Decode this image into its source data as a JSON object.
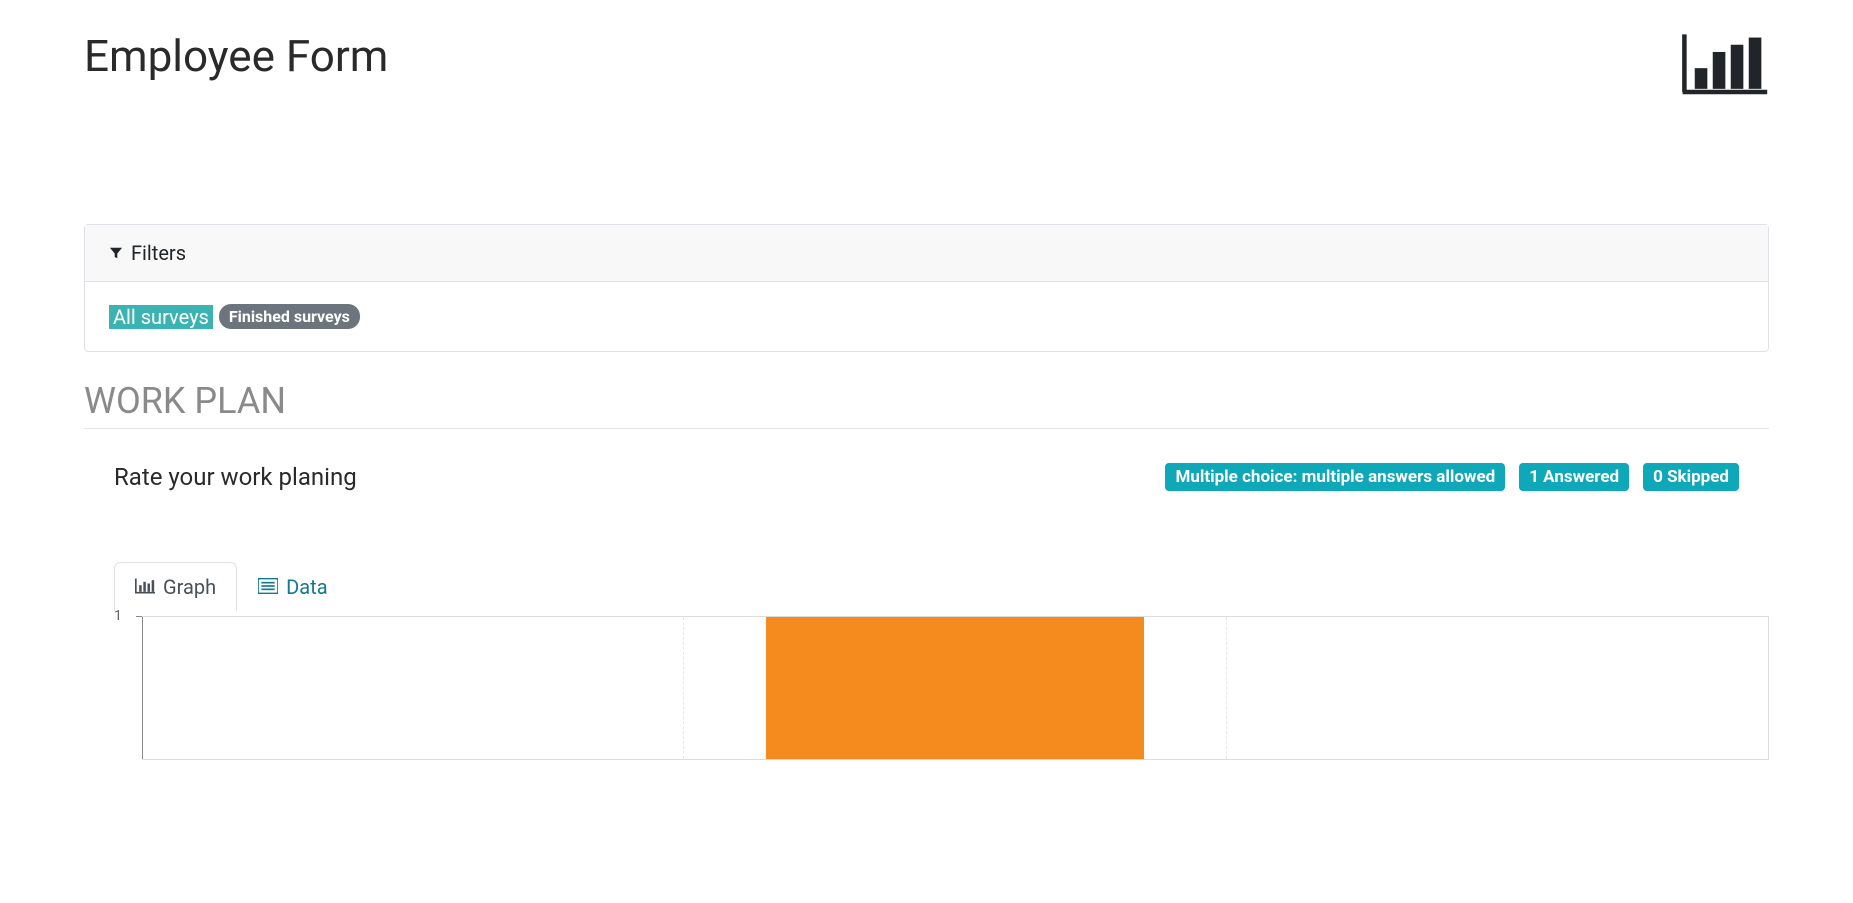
{
  "header": {
    "title": "Employee Form"
  },
  "filters": {
    "label": "Filters",
    "options": [
      {
        "label": "All surveys",
        "active": true
      },
      {
        "label": "Finished surveys",
        "active": false
      }
    ]
  },
  "section": {
    "title": "WORK PLAN"
  },
  "question": {
    "text": "Rate your work planing",
    "badges": {
      "type": "Multiple choice: multiple answers allowed",
      "answered": "1 Answered",
      "skipped": "0 Skipped"
    }
  },
  "tabs": {
    "graph": "Graph",
    "data": "Data"
  },
  "chart_data": {
    "type": "bar",
    "categories": [
      "",
      "",
      ""
    ],
    "values": [
      0,
      1,
      0
    ],
    "title": "",
    "xlabel": "",
    "ylabel": "",
    "ylim": [
      0,
      1
    ],
    "y_ticks": [
      "1"
    ],
    "bar_color": "#f58a1f"
  }
}
